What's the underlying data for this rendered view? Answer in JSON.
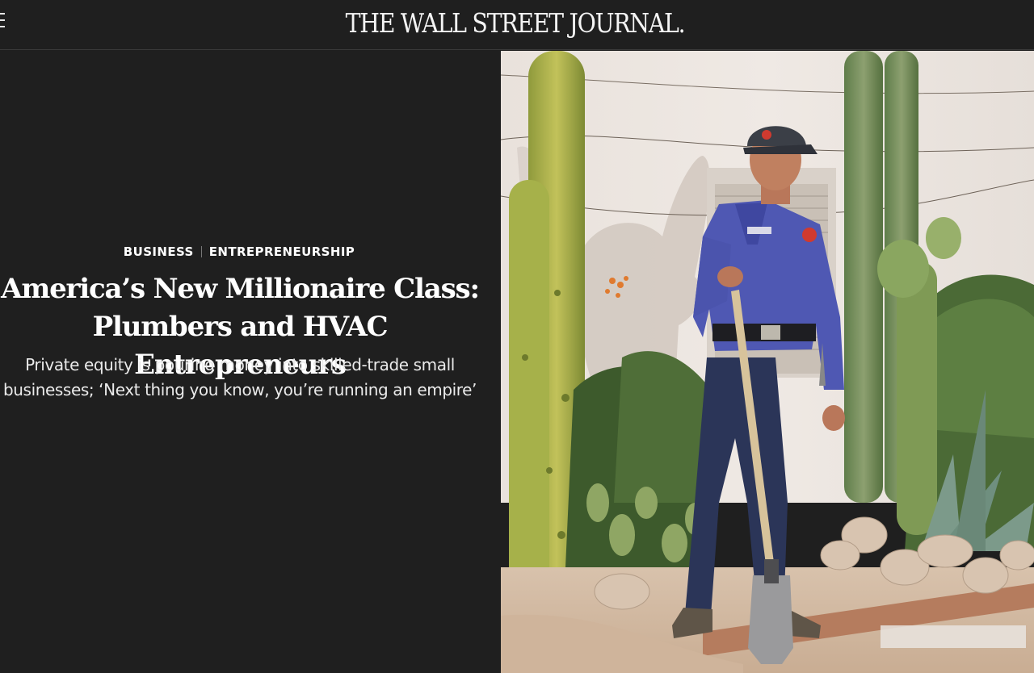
{
  "header": {
    "masthead": "THE WALL STREET JOURNAL."
  },
  "article": {
    "section": "BUSINESS",
    "subsection": "ENTREPRENEURSHIP",
    "headline": "America’s New Millionaire Class: Plumbers and HVAC Entrepreneurs",
    "dek": "Private equity is pouring money into skilled-trade small businesses; ‘Next thing you know, you’re running an empire’"
  },
  "colors": {
    "background": "#1f1f1f",
    "text": "#ffffff",
    "divider": "#3a3a3a"
  },
  "icons": {
    "menu": "hamburger-menu-icon"
  }
}
